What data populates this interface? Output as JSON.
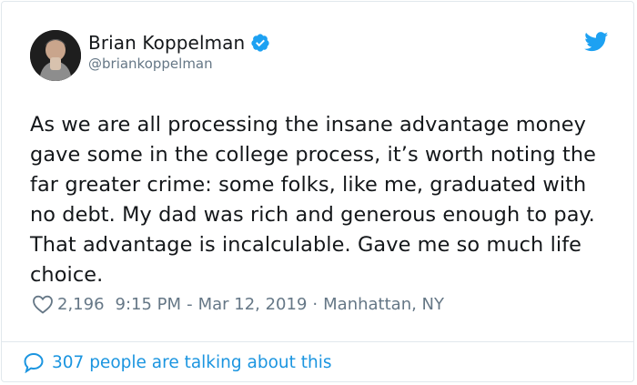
{
  "tweet": {
    "author": {
      "display_name": "Brian Koppelman",
      "handle": "@briankoppelman",
      "verified": true
    },
    "text": "As we are all processing the insane advantage money gave some in the college process, it’s worth noting the far greater crime: some folks, like me, graduated with no debt. My dad was rich and generous enough to pay. That advantage is incalculable. Gave me so much life choice.",
    "likes": "2,196",
    "time": "9:15 PM",
    "date_separator": "-",
    "date": "Mar 12, 2019",
    "location_separator": "·",
    "location": "Manhattan, NY"
  },
  "footer": {
    "talking_label": "307 people are talking about this"
  },
  "colors": {
    "brand_blue": "#1da1f2",
    "link_blue": "#1b95e0",
    "text": "#14171a",
    "muted": "#657786",
    "border": "#e1e8ed"
  },
  "icons": [
    "verified-badge-icon",
    "twitter-bird-icon",
    "heart-icon",
    "speech-bubble-icon"
  ]
}
